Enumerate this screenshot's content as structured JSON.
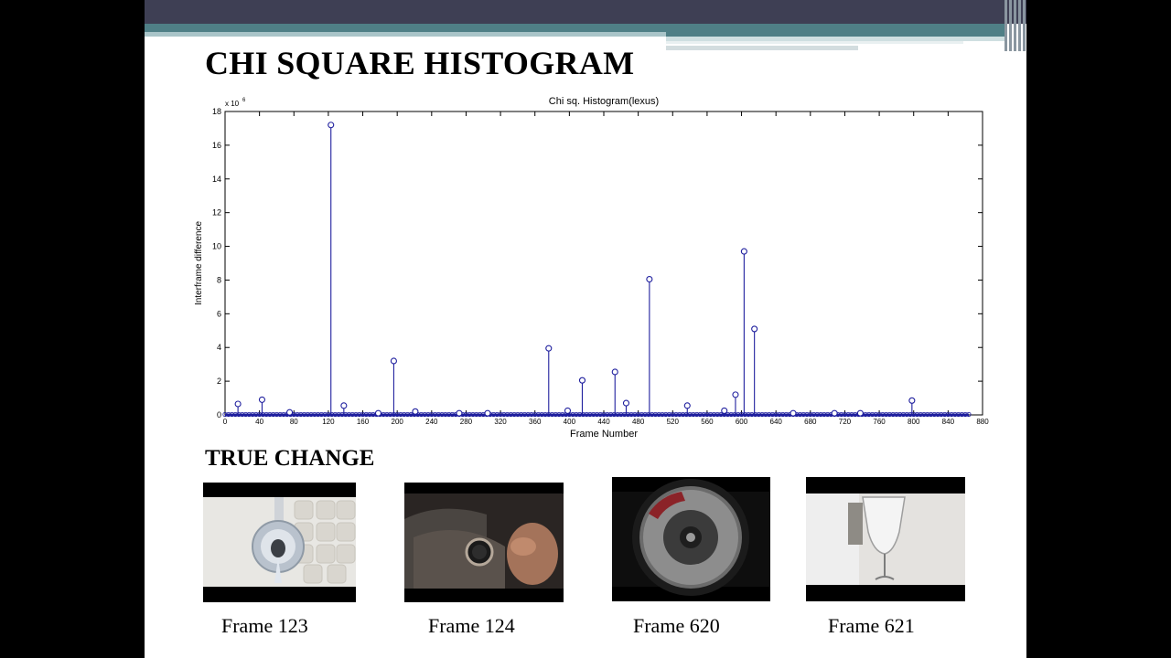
{
  "slide": {
    "title": "CHI SQUARE HISTOGRAM",
    "section_label": "TRUE  CHANGE",
    "frames": [
      {
        "caption": "Frame 123",
        "image": "key-fob-device"
      },
      {
        "caption": "Frame 124",
        "image": "engine-start-button"
      },
      {
        "caption": "Frame 620",
        "image": "wheel-brake-disc"
      },
      {
        "caption": "Frame 621",
        "image": "champagne-glass"
      }
    ]
  },
  "chart_data": {
    "type": "stem",
    "title": "Chi sq. Histogram(lexus)",
    "xlabel": "Frame Number",
    "ylabel": "Interframe difference",
    "y_multiplier_label": "x 10",
    "y_multiplier_exp": "6",
    "xlim": [
      0,
      880
    ],
    "ylim": [
      0,
      18
    ],
    "xticks": [
      0,
      40,
      80,
      120,
      160,
      200,
      240,
      280,
      320,
      360,
      400,
      440,
      480,
      520,
      560,
      600,
      640,
      680,
      720,
      760,
      800,
      840,
      880
    ],
    "yticks": [
      0,
      2,
      4,
      6,
      8,
      10,
      12,
      14,
      16,
      18
    ],
    "n_frames": 864,
    "color": "#1f1f9e",
    "points": [
      {
        "x": 15,
        "y": 0.65
      },
      {
        "x": 43,
        "y": 0.9
      },
      {
        "x": 75,
        "y": 0.15
      },
      {
        "x": 123,
        "y": 17.2
      },
      {
        "x": 138,
        "y": 0.55
      },
      {
        "x": 178,
        "y": 0.1
      },
      {
        "x": 196,
        "y": 3.2
      },
      {
        "x": 221,
        "y": 0.2
      },
      {
        "x": 272,
        "y": 0.1
      },
      {
        "x": 305,
        "y": 0.1
      },
      {
        "x": 376,
        "y": 3.95
      },
      {
        "x": 398,
        "y": 0.25
      },
      {
        "x": 415,
        "y": 2.05
      },
      {
        "x": 453,
        "y": 2.55
      },
      {
        "x": 466,
        "y": 0.7
      },
      {
        "x": 493,
        "y": 8.05
      },
      {
        "x": 537,
        "y": 0.55
      },
      {
        "x": 580,
        "y": 0.25
      },
      {
        "x": 593,
        "y": 1.2
      },
      {
        "x": 603,
        "y": 9.7
      },
      {
        "x": 615,
        "y": 5.1
      },
      {
        "x": 660,
        "y": 0.1
      },
      {
        "x": 708,
        "y": 0.1
      },
      {
        "x": 738,
        "y": 0.1
      },
      {
        "x": 798,
        "y": 0.85
      }
    ]
  }
}
